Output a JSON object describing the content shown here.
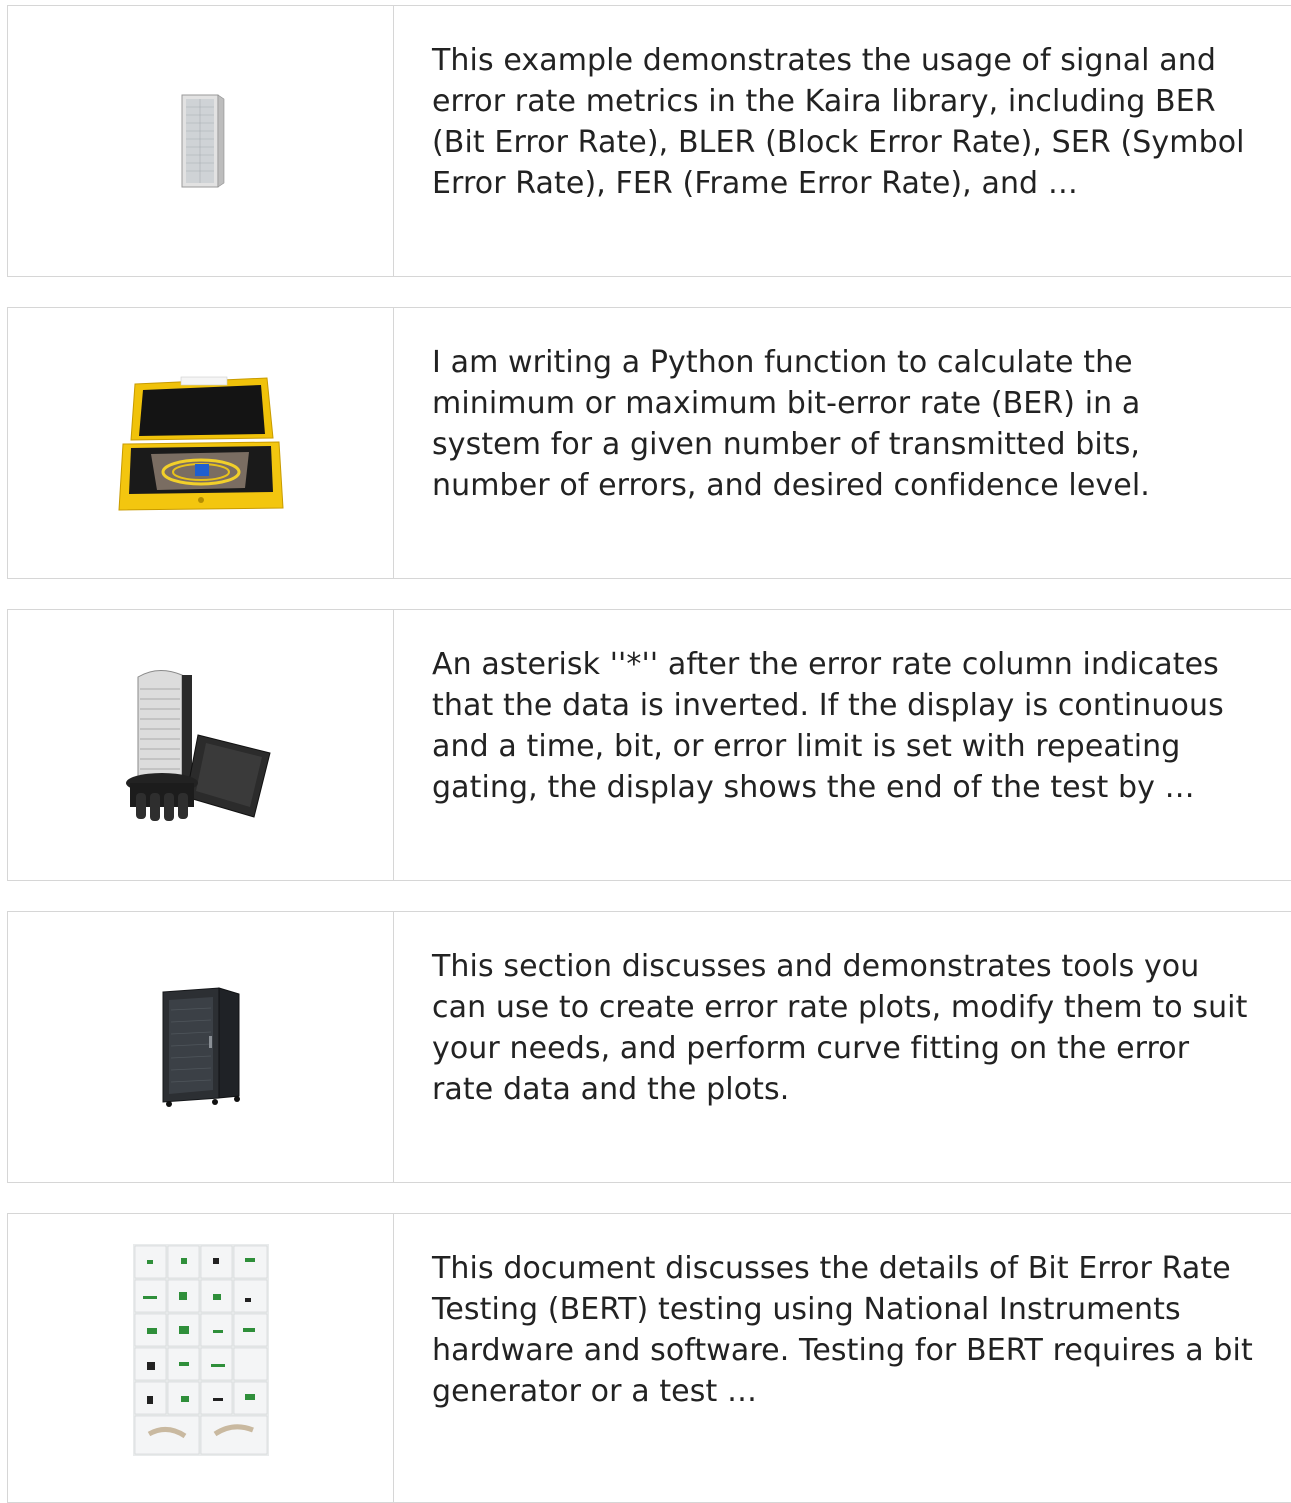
{
  "results": [
    {
      "image_icon": "server-rack-cabinet-image",
      "description": "This example demonstrates the usage of signal and error rate metrics in the Kaira library, including BER (Bit Error Rate), BLER (Block Error Rate), SER (Symbol Error Rate), FER (Frame Error Rate), and …"
    },
    {
      "image_icon": "yellow-fiber-test-case-image",
      "description": "I am writing a Python function to calculate the minimum or maximum bit-error rate (BER) in a system for a given number of transmitted bits, number of errors, and desired confidence level."
    },
    {
      "image_icon": "fiber-splice-closure-image",
      "description": "An asterisk ''*'' after the error rate column indicates that the data is inverted. If the display is continuous and a time, bit, or error limit is set with repeating gating, the display shows the end of the test by …"
    },
    {
      "image_icon": "network-cabinet-image",
      "description": "This section discusses and demonstrates tools you can use to create error rate plots, modify them to suit your needs, and perform curve fitting on the error rate data and the plots."
    },
    {
      "image_icon": "fiber-connector-catalog-image",
      "description": "This document discusses the details of Bit Error Rate Testing (BERT) testing using National Instruments hardware and software. Testing for BERT requires a bit generator or a test …"
    }
  ]
}
